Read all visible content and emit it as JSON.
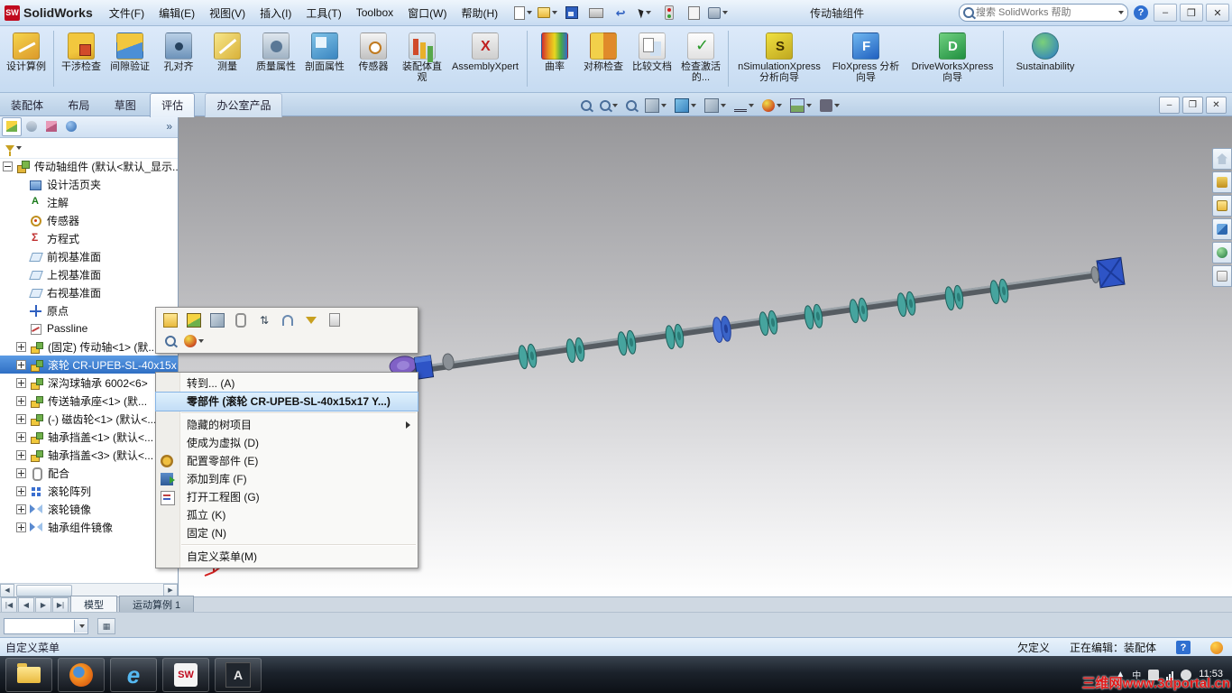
{
  "titlebar": {
    "app_name": "SolidWorks",
    "menus": [
      "文件(F)",
      "编辑(E)",
      "视图(V)",
      "插入(I)",
      "工具(T)",
      "Toolbox",
      "窗口(W)",
      "帮助(H)"
    ],
    "doc_title": "传动轴组件",
    "search_placeholder": "搜索 SolidWorks 帮助"
  },
  "quick_access_icons": [
    "new-document",
    "open",
    "save",
    "print",
    "undo",
    "select",
    "rebuild",
    "file-properties",
    "options"
  ],
  "ribbon": {
    "buttons": [
      {
        "label": "设计算例",
        "icon": "design-study"
      },
      {
        "label": "干涉检查",
        "icon": "interference-check"
      },
      {
        "label": "间隙验证",
        "icon": "clearance-verification"
      },
      {
        "label": "孔对齐",
        "icon": "hole-alignment"
      },
      {
        "label": "测量",
        "icon": "measure"
      },
      {
        "label": "质量属性",
        "icon": "mass-properties"
      },
      {
        "label": "剖面属性",
        "icon": "section-properties"
      },
      {
        "label": "传感器",
        "icon": "sensor"
      },
      {
        "label": "装配体直观",
        "icon": "assembly-visualization"
      },
      {
        "label": "AssemblyXpert",
        "icon": "assembly-xpert"
      },
      {
        "label": "曲率",
        "icon": "curvature"
      },
      {
        "label": "对称检查",
        "icon": "symmetry-check"
      },
      {
        "label": "比较文档",
        "icon": "compare-documents"
      },
      {
        "label": "检查激活的...",
        "icon": "check-active-document"
      },
      {
        "label": "nSimulationXpress 分析向导",
        "icon": "simulationxpress-wizard"
      },
      {
        "label": "FloXpress 分析向导",
        "icon": "floxpress-wizard"
      },
      {
        "label": "DriveWorksXpress 向导",
        "icon": "driveworksxpress-wizard"
      },
      {
        "label": "Sustainability",
        "icon": "sustainability"
      }
    ]
  },
  "doc_tabs": {
    "tabs": [
      "装配体",
      "布局",
      "草图",
      "评估",
      "办公室产品"
    ],
    "active": "评估"
  },
  "view_toolbar_icons": [
    "zoom-fit",
    "zoom-area",
    "previous-view",
    "section-view",
    "view-orientation",
    "display-style",
    "hide-show-items",
    "edit-appearance",
    "apply-scene",
    "view-settings"
  ],
  "panel_tab_icons": [
    "feature-manager",
    "property-manager",
    "configuration-manager",
    "display-manager"
  ],
  "feature_tree": {
    "root": "传动轴组件 (默认<默认_显示...",
    "items": [
      {
        "label": "设计活页夹",
        "icon": "design-binder"
      },
      {
        "label": "注解",
        "icon": "annotations"
      },
      {
        "label": "传感器",
        "icon": "sensors"
      },
      {
        "label": "方程式",
        "icon": "equations"
      },
      {
        "label": "前视基准面",
        "icon": "plane"
      },
      {
        "label": "上视基准面",
        "icon": "plane"
      },
      {
        "label": "右视基准面",
        "icon": "plane"
      },
      {
        "label": "原点",
        "icon": "origin"
      },
      {
        "label": "Passline",
        "icon": "sketch"
      },
      {
        "label": "(固定) 传动轴<1> (默...",
        "icon": "part"
      },
      {
        "label": "滚轮 CR-UPEB-SL-40x15x",
        "icon": "part",
        "selected": true
      },
      {
        "label": "深沟球轴承 6002<6>",
        "icon": "part"
      },
      {
        "label": "传送轴承座<1> (默...",
        "icon": "part"
      },
      {
        "label": "(-) 磁齿轮<1> (默认<...",
        "icon": "part"
      },
      {
        "label": "轴承挡盖<1> (默认<...",
        "icon": "part"
      },
      {
        "label": "轴承挡盖<3> (默认<...",
        "icon": "part"
      },
      {
        "label": "配合",
        "icon": "mates"
      },
      {
        "label": "滚轮阵列",
        "icon": "pattern"
      },
      {
        "label": "滚轮镜像",
        "icon": "mirror"
      },
      {
        "label": "轴承组件镜像",
        "icon": "mirror"
      }
    ]
  },
  "context_toolbar_icons": [
    "open-part",
    "insert-component",
    "isolate-component",
    "mate",
    "sort",
    "attachment",
    "selection-filter",
    "properties",
    "magnifier",
    "appearance"
  ],
  "context_menu": {
    "items": {
      "goto": "转到... (A)",
      "component": "零部件 (滚轮 CR-UPEB-SL-40x15x17 Y...)",
      "hidden_tree": "隐藏的树项目",
      "make_virtual": "使成为虚拟 (D)",
      "configure": "配置零部件 (E)",
      "add_library": "添加到库 (F)",
      "open_drawing": "打开工程图 (G)",
      "isolate": "孤立 (K)",
      "fix": "固定 (N)",
      "customize": "自定义菜单(M)"
    }
  },
  "task_pane_icons": [
    "home",
    "design-library",
    "file-explorer",
    "view-palette",
    "appearances",
    "custom-properties"
  ],
  "model_tabs": {
    "tabs": [
      "模型",
      "运动算例 1"
    ],
    "active": "模型"
  },
  "status_bar": {
    "message": "自定义菜单",
    "definition": "欠定义",
    "editing": "正在编辑：装配体"
  },
  "taskbar": {
    "apps": [
      "file-explorer",
      "firefox",
      "internet-explorer",
      "solidworks",
      "app-a"
    ],
    "time": "11:53",
    "watermark": "三维网www.3dportal.cn"
  }
}
